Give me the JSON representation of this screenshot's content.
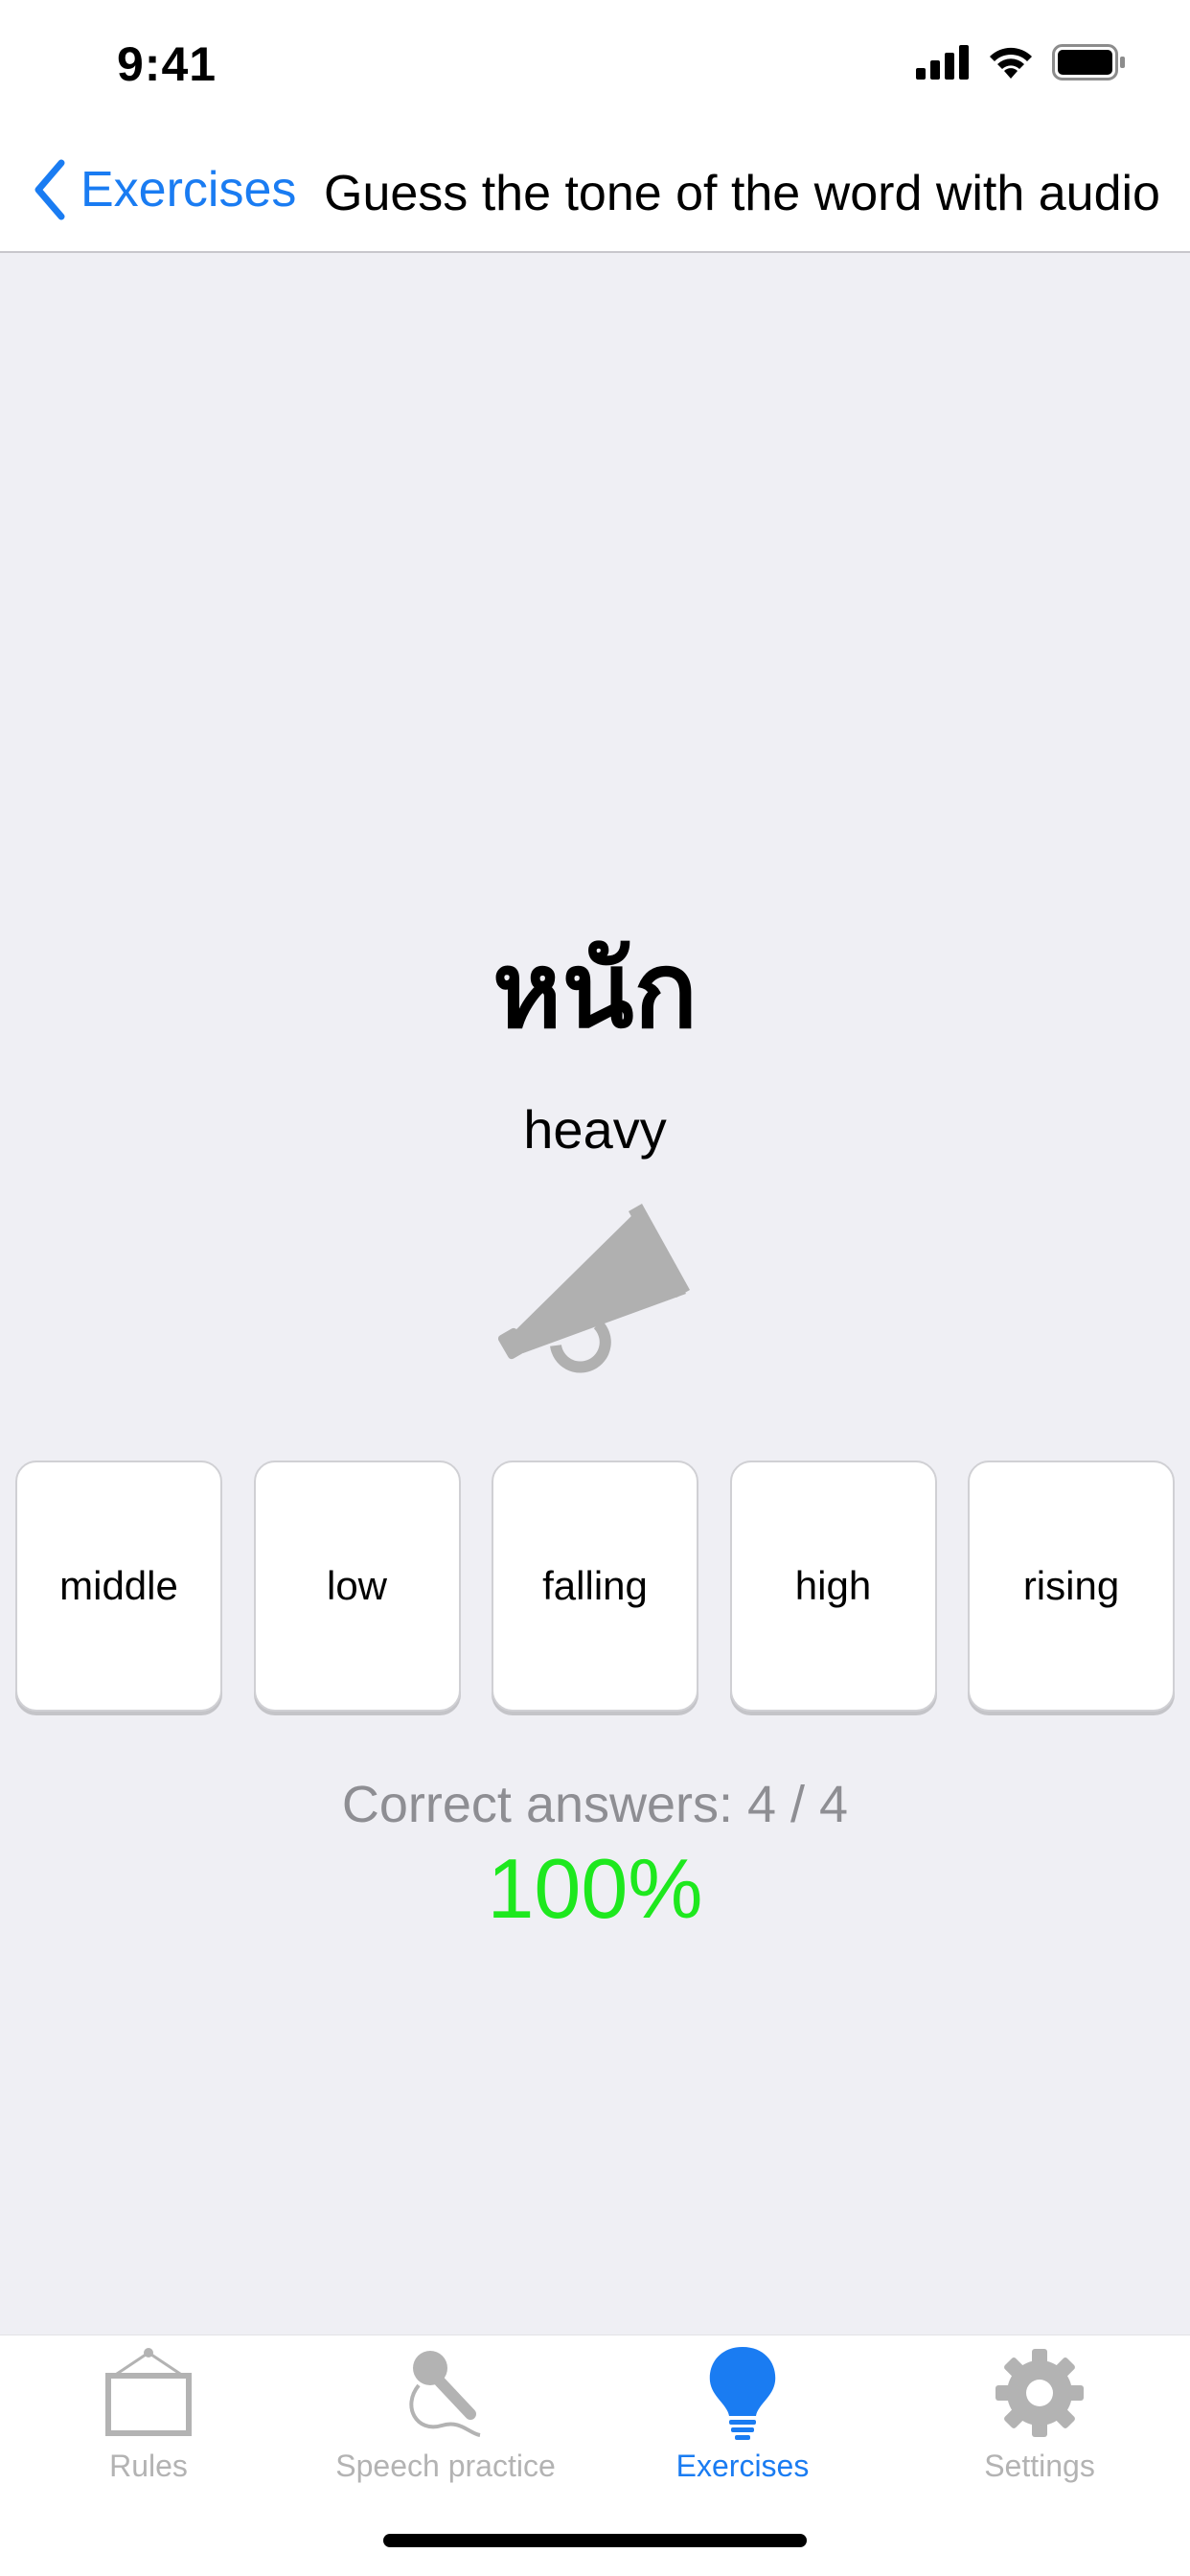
{
  "status_bar": {
    "time": "9:41"
  },
  "nav": {
    "back_label": "Exercises",
    "title": "Guess the tone of the word with audio"
  },
  "exercise": {
    "thai_word": "หนัก",
    "translation": "heavy",
    "options": [
      "middle",
      "low",
      "falling",
      "high",
      "rising"
    ]
  },
  "score": {
    "label": "Correct answers: 4 / 4",
    "percent": "100%"
  },
  "tabs": [
    {
      "label": "Rules",
      "icon": "board-icon",
      "active": false
    },
    {
      "label": "Speech practice",
      "icon": "microphone-icon",
      "active": false
    },
    {
      "label": "Exercises",
      "icon": "lightbulb-icon",
      "active": true
    },
    {
      "label": "Settings",
      "icon": "gear-icon",
      "active": false
    }
  ],
  "colors": {
    "accent": "#1a7cf2",
    "background": "#efeff4",
    "score_success": "#1ee81e",
    "inactive": "#b3b3b3"
  }
}
